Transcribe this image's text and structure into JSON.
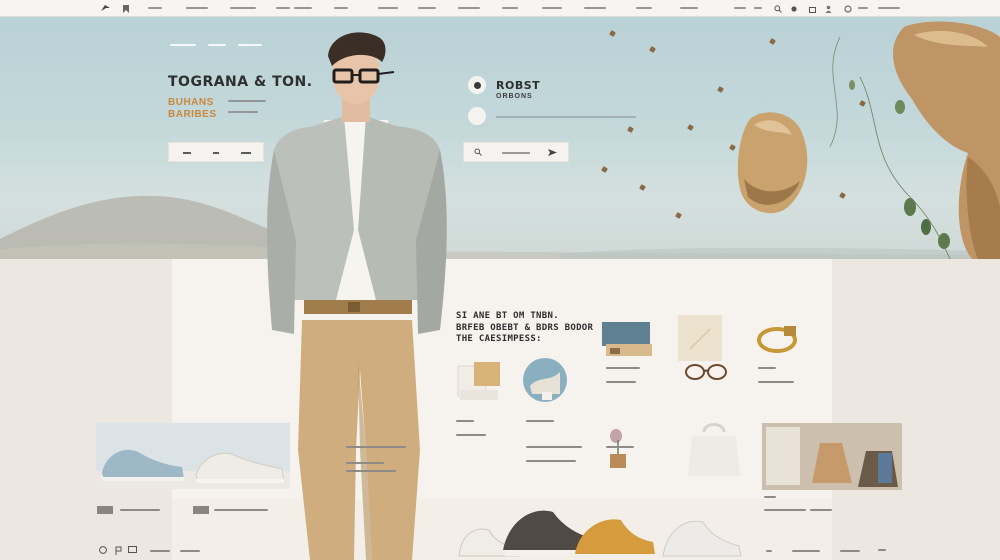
{
  "nav": {
    "logo_icon": "bird-logo-icon",
    "icons": [
      "bookmark-icon",
      "search-icon",
      "heart-icon",
      "bag-icon",
      "user-icon",
      "globe-icon"
    ]
  },
  "hero": {
    "title": "TOGRANA & TON.",
    "subtitle_line1": "BUHANS",
    "subtitle_line2": "BARIBES",
    "promo_title": "ROBST",
    "promo_subtitle": "ORBONS",
    "colors": {
      "sky": "#c4d8da",
      "accent": "#c9883c",
      "rock": "#c9a26e"
    }
  },
  "section": {
    "title_line1": "SI ANE BT OM TNBN.",
    "title_line2": "BRFEB OBEBT & BDRS BODOR",
    "title_line3": "THE CAESIMPESS:"
  },
  "products": [
    {
      "icon": "speaker-icon"
    },
    {
      "icon": "notebook-icon"
    },
    {
      "icon": "bracelet-icon"
    },
    {
      "icon": "cushion-icon"
    },
    {
      "icon": "compass-icon"
    },
    {
      "icon": "flower-vase-icon"
    },
    {
      "icon": "bag-icon"
    },
    {
      "icon": "sunglasses-icon"
    }
  ],
  "banners": {
    "left": "sneakers-banner-image",
    "right": "accessories-banner-image"
  },
  "footer": {
    "icons": [
      "instagram-icon",
      "pinterest-icon",
      "chat-icon"
    ]
  }
}
